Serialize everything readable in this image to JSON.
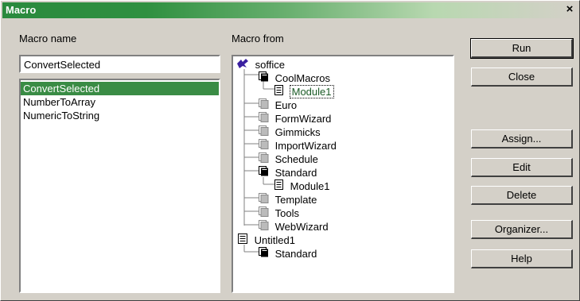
{
  "window": {
    "title": "Macro",
    "close_glyph": "×"
  },
  "macro_name": {
    "label": "Macro name",
    "input_value": "ConvertSelected",
    "items": [
      "ConvertSelected",
      "NumberToArray",
      "NumericToString"
    ],
    "selected_index": 0
  },
  "macro_from": {
    "label": "Macro from",
    "tree": [
      {
        "label": "soffice",
        "icon": "libraries-root-icon"
      },
      {
        "label": "CoolMacros",
        "icon": "library-icon"
      },
      {
        "label": "Module1",
        "icon": "module-icon",
        "selected": true
      },
      {
        "label": "Euro",
        "icon": "library-icon"
      },
      {
        "label": "FormWizard",
        "icon": "library-icon"
      },
      {
        "label": "Gimmicks",
        "icon": "library-icon"
      },
      {
        "label": "ImportWizard",
        "icon": "library-icon"
      },
      {
        "label": "Schedule",
        "icon": "library-icon"
      },
      {
        "label": "Standard",
        "icon": "library-icon"
      },
      {
        "label": "Module1",
        "icon": "module-icon"
      },
      {
        "label": "Template",
        "icon": "library-icon"
      },
      {
        "label": "Tools",
        "icon": "library-icon"
      },
      {
        "label": "WebWizard",
        "icon": "library-icon"
      },
      {
        "label": "Untitled1",
        "icon": "document-icon"
      },
      {
        "label": "Standard",
        "icon": "library-icon"
      }
    ]
  },
  "buttons": {
    "run": "Run",
    "close": "Close",
    "assign": "Assign...",
    "edit": "Edit",
    "delete": "Delete",
    "organizer": "Organizer...",
    "help": "Help"
  },
  "colors": {
    "selection": "#3a8c45",
    "title_start": "#2a8a3e"
  }
}
